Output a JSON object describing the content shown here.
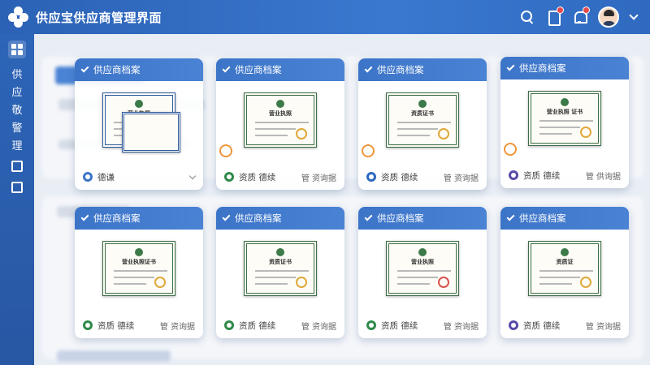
{
  "app": {
    "title": "供应宝供应商管理界面"
  },
  "sidebar": {
    "chars": [
      "供",
      "应",
      "敬",
      "警",
      "理"
    ]
  },
  "cards": [
    {
      "title": "供应商档案",
      "foot_left": "德谦",
      "foot_right": "",
      "icon_color": "#3c74c8",
      "style": "blue"
    },
    {
      "title": "供应商档案",
      "foot_left": "资质 德续",
      "foot_right": "管 资询据",
      "icon_color": "#2f8a4a",
      "style": "green"
    },
    {
      "title": "供应商档案",
      "foot_left": "资质 德续",
      "foot_right": "管 资询据",
      "icon_color": "#2f6ac0",
      "style": "green"
    },
    {
      "title": "供应商档案",
      "foot_left": "资质 德续",
      "foot_right": "管 供询据",
      "icon_color": "#5b4aa8",
      "style": "green"
    },
    {
      "title": "供应商档案",
      "foot_left": "资质 德续",
      "foot_right": "管 资询据",
      "icon_color": "#2f8a4a",
      "style": "green"
    },
    {
      "title": "供应商档案",
      "foot_left": "资质 德续",
      "foot_right": "管 资询据",
      "icon_color": "#2f8a4a",
      "style": "green"
    },
    {
      "title": "供应商档案",
      "foot_left": "资质 德续",
      "foot_right": "管 资询据",
      "icon_color": "#2f8a4a",
      "style": "green"
    },
    {
      "title": "供应商档案",
      "foot_left": "资质 德续",
      "foot_right": "管 资询据",
      "icon_color": "#5b4aa8",
      "style": "green"
    }
  ],
  "cert_titles": [
    "营业执照",
    "营业执照",
    "资质证书",
    "营业执照 证书",
    "营业执照证书",
    "资质证书",
    "营业执照",
    "资质证"
  ]
}
